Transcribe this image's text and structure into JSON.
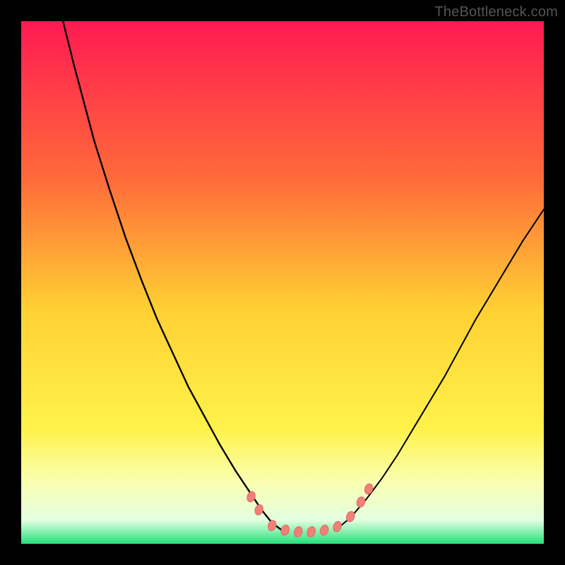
{
  "watermark": "TheBottleneck.com",
  "chart_data": {
    "type": "line",
    "title": "",
    "xlabel": "",
    "ylabel": "",
    "xlim": [
      0,
      100
    ],
    "ylim": [
      0,
      100
    ],
    "background_gradient": {
      "stops": [
        {
          "offset": 0,
          "color": "#ff1a52"
        },
        {
          "offset": 0.3,
          "color": "#ff6a3a"
        },
        {
          "offset": 0.55,
          "color": "#ffd033"
        },
        {
          "offset": 0.78,
          "color": "#fff24a"
        },
        {
          "offset": 0.88,
          "color": "#faffb0"
        },
        {
          "offset": 0.955,
          "color": "#e3ffe0"
        },
        {
          "offset": 1.0,
          "color": "#23e07a"
        }
      ]
    },
    "series": [
      {
        "name": "left-curve",
        "stroke": "#000000",
        "stroke_width": 2.4,
        "x": [
          8,
          10,
          12,
          14,
          17,
          20,
          23,
          26,
          29,
          32,
          35,
          38,
          41,
          44,
          46,
          48,
          50
        ],
        "y": [
          100,
          92,
          84.5,
          77,
          67.5,
          58.5,
          50.5,
          43,
          36.5,
          30,
          24.5,
          19,
          14,
          9.5,
          6.5,
          4,
          2.5
        ]
      },
      {
        "name": "right-curve",
        "stroke": "#000000",
        "stroke_width": 2.0,
        "x": [
          60,
          63,
          66,
          69,
          72,
          75,
          78,
          81,
          84,
          87,
          90,
          93,
          96,
          99,
          100
        ],
        "y": [
          2.5,
          5,
          8.5,
          12.5,
          17,
          22,
          27,
          32,
          37.5,
          43,
          48,
          53,
          58,
          62.5,
          64
        ]
      }
    ],
    "markers": {
      "name": "optimum-markers",
      "fill": "#f08078",
      "stroke": "#e06a62",
      "rx": 5.5,
      "ry": 7.5,
      "rotate_deg": 18,
      "points": [
        {
          "x": 44.0,
          "y": 9.0
        },
        {
          "x": 45.5,
          "y": 6.5
        },
        {
          "x": 48.0,
          "y": 3.5
        },
        {
          "x": 50.5,
          "y": 2.6
        },
        {
          "x": 53.0,
          "y": 2.3
        },
        {
          "x": 55.5,
          "y": 2.3
        },
        {
          "x": 58.0,
          "y": 2.6
        },
        {
          "x": 60.5,
          "y": 3.3
        },
        {
          "x": 63.0,
          "y": 5.2
        },
        {
          "x": 65.0,
          "y": 8.0
        },
        {
          "x": 66.5,
          "y": 10.5
        }
      ]
    }
  }
}
